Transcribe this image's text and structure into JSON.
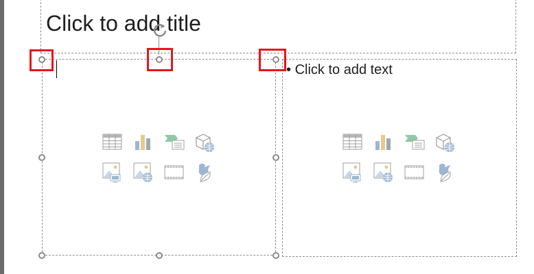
{
  "slide": {
    "title_placeholder": "Click to add title",
    "content_placeholder_right": "Click to add text",
    "bullet": "•"
  },
  "content_icons": [
    "insert-table-icon",
    "insert-chart-icon",
    "insert-smartart-icon",
    "insert-3d-model-icon",
    "insert-pictures-icon",
    "online-pictures-icon",
    "insert-video-icon",
    "insert-icons-icon"
  ],
  "colors": {
    "selection_highlight": "#e8141c",
    "handle": "#8a8a8a",
    "icon_blue": "#9bb7d4",
    "icon_gold": "#e8c98a",
    "icon_green": "#8fc9a8"
  }
}
